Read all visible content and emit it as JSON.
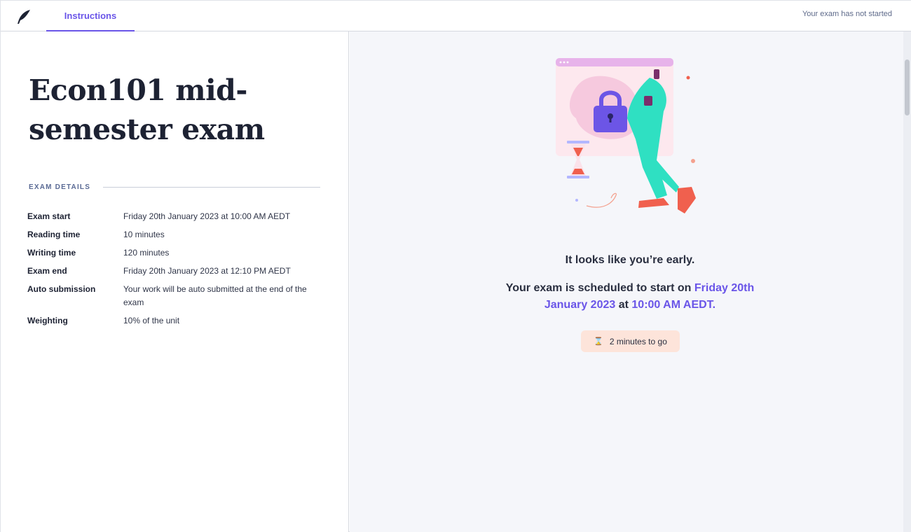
{
  "header": {
    "logo_icon": "quill-icon",
    "tab_label": "Instructions",
    "status": "Your exam has not started"
  },
  "exam": {
    "title": "Econ101 mid-semester exam",
    "section_title": "EXAM DETAILS",
    "details": [
      {
        "label": "Exam start",
        "value": "Friday 20th January 2023 at 10:00 AM AEDT"
      },
      {
        "label": "Reading time",
        "value": "10 minutes"
      },
      {
        "label": "Writing time",
        "value": "120 minutes"
      },
      {
        "label": "Exam end",
        "value": "Friday 20th January 2023 at 12:10 PM AEDT"
      },
      {
        "label": "Auto submission",
        "value": "Your work will be auto submitted at the end of the exam"
      },
      {
        "label": "Weighting",
        "value": "10% of the unit"
      }
    ]
  },
  "notice": {
    "early_text": "It looks like you’re early.",
    "sched_prefix": "Your exam is scheduled to start on ",
    "sched_date": "Friday 20th January 2023",
    "sched_mid": " at ",
    "sched_time": "10:00 AM AEDT.",
    "countdown_icon": "hourglass-icon",
    "countdown": "2 minutes to go"
  },
  "colors": {
    "accent": "#6a55e8",
    "chip_bg": "#fde4da",
    "panel_bg": "#f5f6fa"
  }
}
